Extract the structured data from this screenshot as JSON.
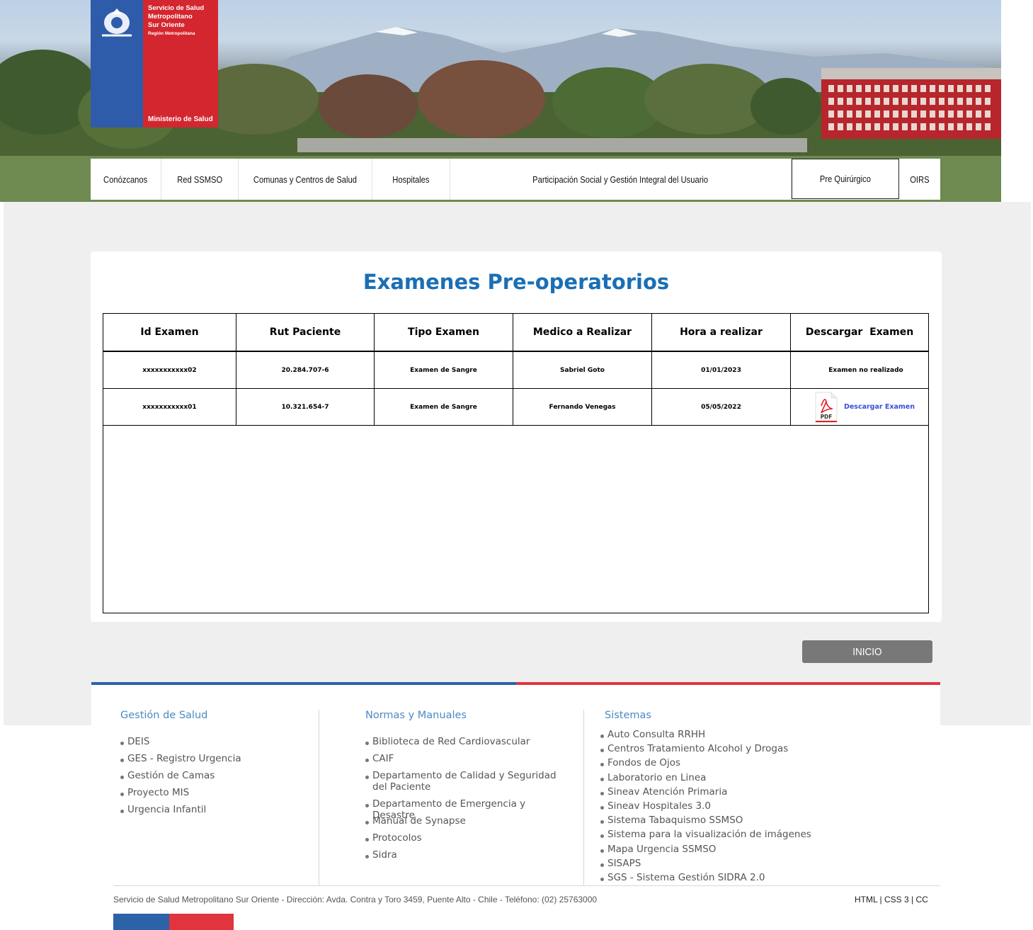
{
  "header": {
    "logo": {
      "line1": "Servicio de Salud",
      "line2": "Metropolitano",
      "line3": "Sur Oriente",
      "region": "Región Metropolitana",
      "ministry": "Ministerio de Salud"
    },
    "nav": [
      {
        "label": "Conózcanos"
      },
      {
        "label": "Red SSMSO"
      },
      {
        "label": "Comunas y Centros de Salud"
      },
      {
        "label": "Hospitales"
      },
      {
        "label": "Participación Social y Gestión Integral del Usuario"
      },
      {
        "label": "Pre Quirúrgico",
        "active": true
      },
      {
        "label": "OIRS"
      }
    ]
  },
  "main": {
    "title": "Examenes Pre-operatorios",
    "table": {
      "columns": [
        "Id Examen",
        "Rut Paciente",
        "Tipo Examen",
        "Medico a Realizar",
        "Hora a realizar",
        "Descargar  Examen"
      ],
      "rows": [
        {
          "id": "xxxxxxxxxxx02",
          "rut": "20.284.707-6",
          "tipo": "Examen de Sangre",
          "medico": "Sabriel Goto",
          "hora": "01/01/2023",
          "descarga": "Examen no realizado",
          "has_pdf": false
        },
        {
          "id": "xxxxxxxxxxx01",
          "rut": "10.321.654-7",
          "tipo": "Examen de Sangre",
          "medico": "Fernando Venegas",
          "hora": "05/05/2022",
          "descarga": "Descargar Examen",
          "has_pdf": true,
          "pdf_label": "PDF"
        }
      ]
    },
    "inicio_button": "INICIO"
  },
  "footer": {
    "colors": {
      "blue": "#2b62a8",
      "red": "#e0343f",
      "title": "#4a8ac4"
    },
    "gestion": {
      "title": "Gestión de Salud",
      "items": [
        "DEIS",
        "GES - Registro Urgencia",
        "Gestión de Camas",
        "Proyecto MIS",
        "Urgencia Infantil"
      ]
    },
    "normas": {
      "title": "Normas y Manuales",
      "items": [
        "Biblioteca de Red Cardiovascular",
        "CAIF",
        "Departamento de Calidad y Seguridad del Paciente",
        "Departamento de Emergencia y Desastre",
        "Manual de Synapse",
        "Protocolos",
        "Sidra"
      ]
    },
    "sistemas": {
      "title": "Sistemas",
      "items": [
        "Auto Consulta RRHH",
        "Centros Tratamiento Alcohol y Drogas",
        "Fondos de Ojos",
        "Laboratorio en Linea",
        "Sineav Atención Primaria",
        "Sineav Hospitales 3.0",
        "Sistema Tabaquismo SSMSO",
        "Sistema para la visualización de imágenes",
        "Mapa Urgencia SSMSO",
        "SISAPS",
        "SGS - Sistema Gestión SIDRA 2.0"
      ]
    },
    "address": "Servicio de Salud Metropolitano Sur Oriente - Dirección: Avda. Contra y Toro 3459, Puente Alto - Chile - Teléfono: (02) 25763000",
    "techs": "HTML | CSS 3 | CC"
  }
}
